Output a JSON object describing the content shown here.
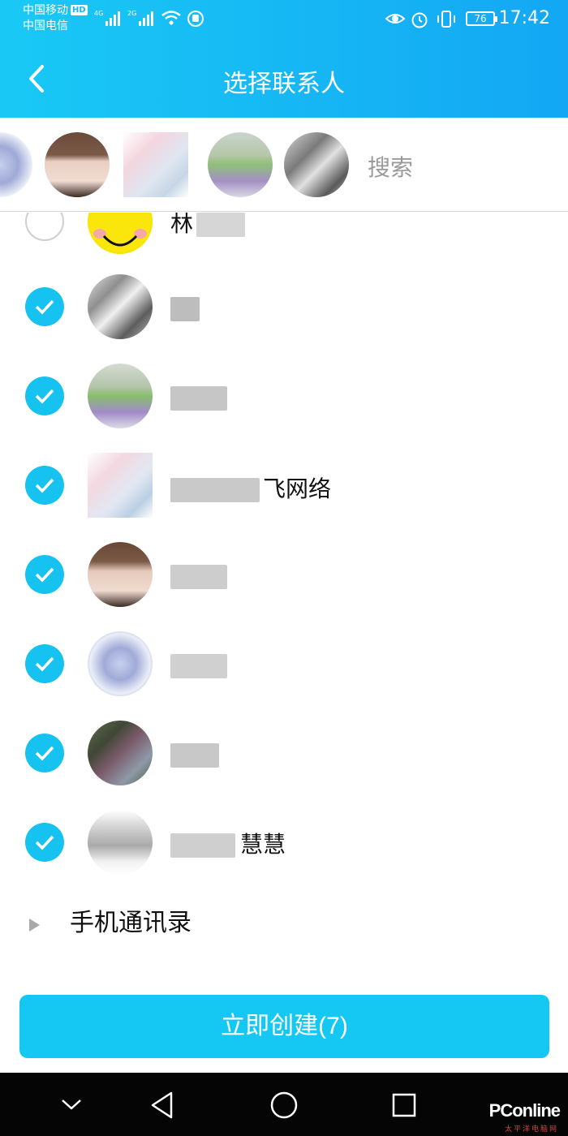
{
  "status_bar": {
    "carrier_1": "中国移动",
    "hd_badge": "HD",
    "carrier_2": "中国电信",
    "net_1": "4G",
    "net_2": "2G",
    "battery": "76",
    "time": "17:42"
  },
  "header": {
    "title": "选择联系人",
    "back_icon": "chevron-left-icon"
  },
  "selected_bar": {
    "search_placeholder": "搜索",
    "avatar_count": 5
  },
  "contacts": [
    {
      "name": "林",
      "checked": false
    },
    {
      "name": "",
      "checked": true
    },
    {
      "name": "",
      "checked": true
    },
    {
      "name": "飞网络",
      "checked": true
    },
    {
      "name": "",
      "checked": true
    },
    {
      "name": "",
      "checked": true
    },
    {
      "name": "",
      "checked": true
    },
    {
      "name": "慧慧",
      "checked": true
    }
  ],
  "phone_contacts": {
    "label": "手机通讯录"
  },
  "create_button": {
    "label": "立即创建(7)"
  },
  "watermark": {
    "main": "PConline",
    "sub": "太平洋电脑网"
  },
  "colors": {
    "accent": "#16c2f0",
    "header_start": "#19c9f5",
    "header_end": "#13a7f4"
  }
}
